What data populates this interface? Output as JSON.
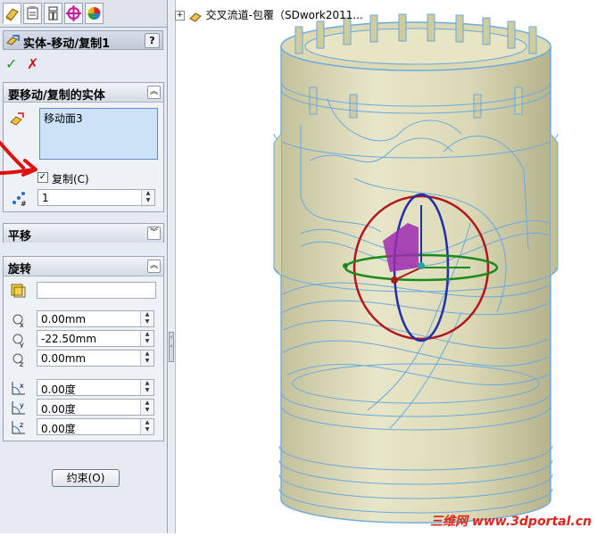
{
  "property_manager": {
    "title": "实体-移动/复制1",
    "help_label": "?",
    "ok_label": "✓",
    "cancel_label": "✗"
  },
  "bodies_group": {
    "header": "要移动/复制的实体",
    "selected_item": "移动面3",
    "copy_label": "复制(C)",
    "copy_checked": true,
    "copy_count": "1"
  },
  "translate_group": {
    "header": "平移"
  },
  "rotate_group": {
    "header": "旋转",
    "reference_value": "",
    "x_origin": "0.00mm",
    "y_origin": "-22.50mm",
    "z_origin": "0.00mm",
    "x_angle": "0.00度",
    "y_angle": "0.00度",
    "z_angle": "0.00度"
  },
  "constraints_button": "约束(O)",
  "feature_tree": {
    "root_label": "交叉流道-包覆（SDwork2011..."
  },
  "watermark": "三维网 www.3dportal.cn",
  "colors": {
    "part_body": "#cfcc9e",
    "edges": "#6aa8e0",
    "triad_red": "#b3151c",
    "triad_blue": "#1f2fa6",
    "triad_green": "#1a8a1a",
    "accent_magenta": "#a02ab0"
  }
}
